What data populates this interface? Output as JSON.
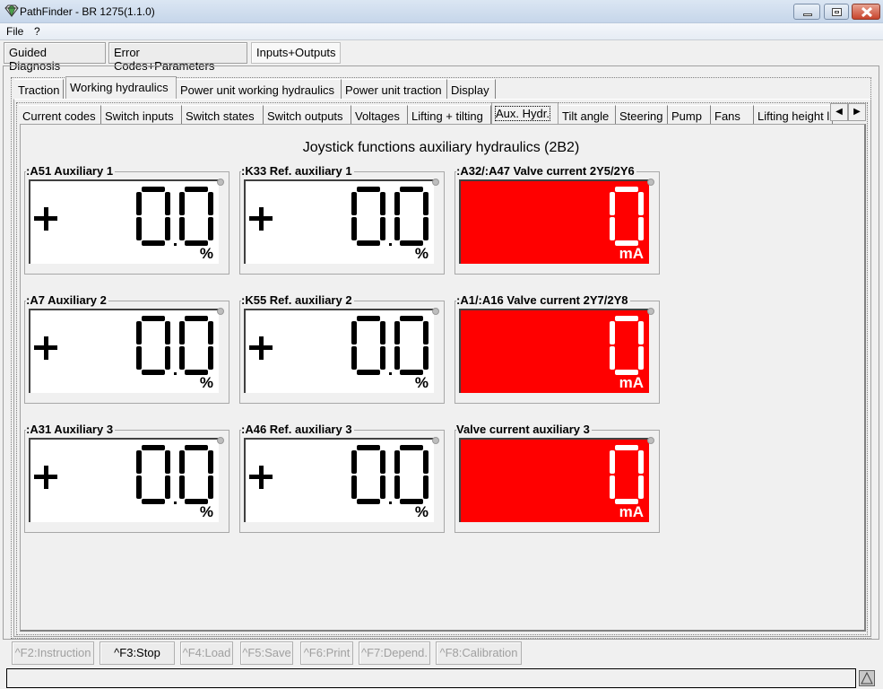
{
  "window": {
    "title": "PathFinder - BR 1275(1.1.0)",
    "icon": "diamond-icon",
    "controls": [
      "minimize",
      "maximize",
      "close"
    ]
  },
  "menu": {
    "items": [
      "File",
      "?"
    ]
  },
  "top_buttons": [
    {
      "label": "Guided Diagnosis",
      "active": false
    },
    {
      "label": "Error Codes+Parameters",
      "active": false
    },
    {
      "label": "Inputs+Outputs",
      "active": true
    }
  ],
  "tabs_level1": [
    {
      "label": "Traction",
      "selected": false
    },
    {
      "label": "Working hydraulics",
      "selected": true
    },
    {
      "label": "Power unit working hydraulics",
      "selected": false
    },
    {
      "label": "Power unit traction",
      "selected": false
    },
    {
      "label": "Display",
      "selected": false
    }
  ],
  "tabs_level2": [
    {
      "label": "Current codes",
      "selected": false
    },
    {
      "label": "Switch inputs",
      "selected": false
    },
    {
      "label": "Switch states",
      "selected": false
    },
    {
      "label": "Switch outputs",
      "selected": false
    },
    {
      "label": "Voltages",
      "selected": false
    },
    {
      "label": "Lifting + tilting",
      "selected": false
    },
    {
      "label": "Aux. Hydr.",
      "selected": true
    },
    {
      "label": "Tilt angle",
      "selected": false
    },
    {
      "label": "Steering",
      "selected": false
    },
    {
      "label": "Pump",
      "selected": false
    },
    {
      "label": "Fans",
      "selected": false
    },
    {
      "label": "Lifting height l",
      "selected": false
    }
  ],
  "tab_scroll": {
    "left": "◀",
    "right": "▶"
  },
  "section_title": "Joystick functions auxiliary hydraulics (2B2)",
  "gauges": [
    {
      "label": ":A51 Auxiliary 1",
      "value": "0.0",
      "unit": "%",
      "signed": true,
      "alarm": false
    },
    {
      "label": ":K33 Ref. auxiliary 1",
      "value": "0.0",
      "unit": "%",
      "signed": true,
      "alarm": false
    },
    {
      "label": ":A32/:A47 Valve current 2Y5/2Y6",
      "value": "0",
      "unit": "mA",
      "signed": false,
      "alarm": true
    },
    {
      "label": ":A7 Auxiliary 2",
      "value": "0.0",
      "unit": "%",
      "signed": true,
      "alarm": false
    },
    {
      "label": ":K55 Ref. auxiliary 2",
      "value": "0.0",
      "unit": "%",
      "signed": true,
      "alarm": false
    },
    {
      "label": ":A1/:A16 Valve current 2Y7/2Y8",
      "value": "0",
      "unit": "mA",
      "signed": false,
      "alarm": true
    },
    {
      "label": ":A31 Auxiliary 3",
      "value": "0.0",
      "unit": "%",
      "signed": true,
      "alarm": false
    },
    {
      "label": ":A46 Ref. auxiliary 3",
      "value": "0.0",
      "unit": "%",
      "signed": true,
      "alarm": false
    },
    {
      "label": "Valve current auxiliary 3",
      "value": "0",
      "unit": "mA",
      "signed": false,
      "alarm": true
    }
  ],
  "function_buttons": [
    {
      "label": "^F2:Instruction",
      "enabled": false
    },
    {
      "label": "^F3:Stop",
      "enabled": true
    },
    {
      "label": "^F4:Load",
      "enabled": false
    },
    {
      "label": "^F5:Save",
      "enabled": false
    },
    {
      "label": "^F6:Print",
      "enabled": false
    },
    {
      "label": "^F7:Depend.",
      "enabled": false
    },
    {
      "label": "^F8:Calibration",
      "enabled": false
    }
  ],
  "status": {
    "text": "",
    "expand_icon": "triangle-up-icon"
  },
  "colors": {
    "alarm": "#ff0000",
    "display_bg": "#ffffff",
    "segment_dark": "#000000",
    "segment_light": "#ffffff"
  }
}
